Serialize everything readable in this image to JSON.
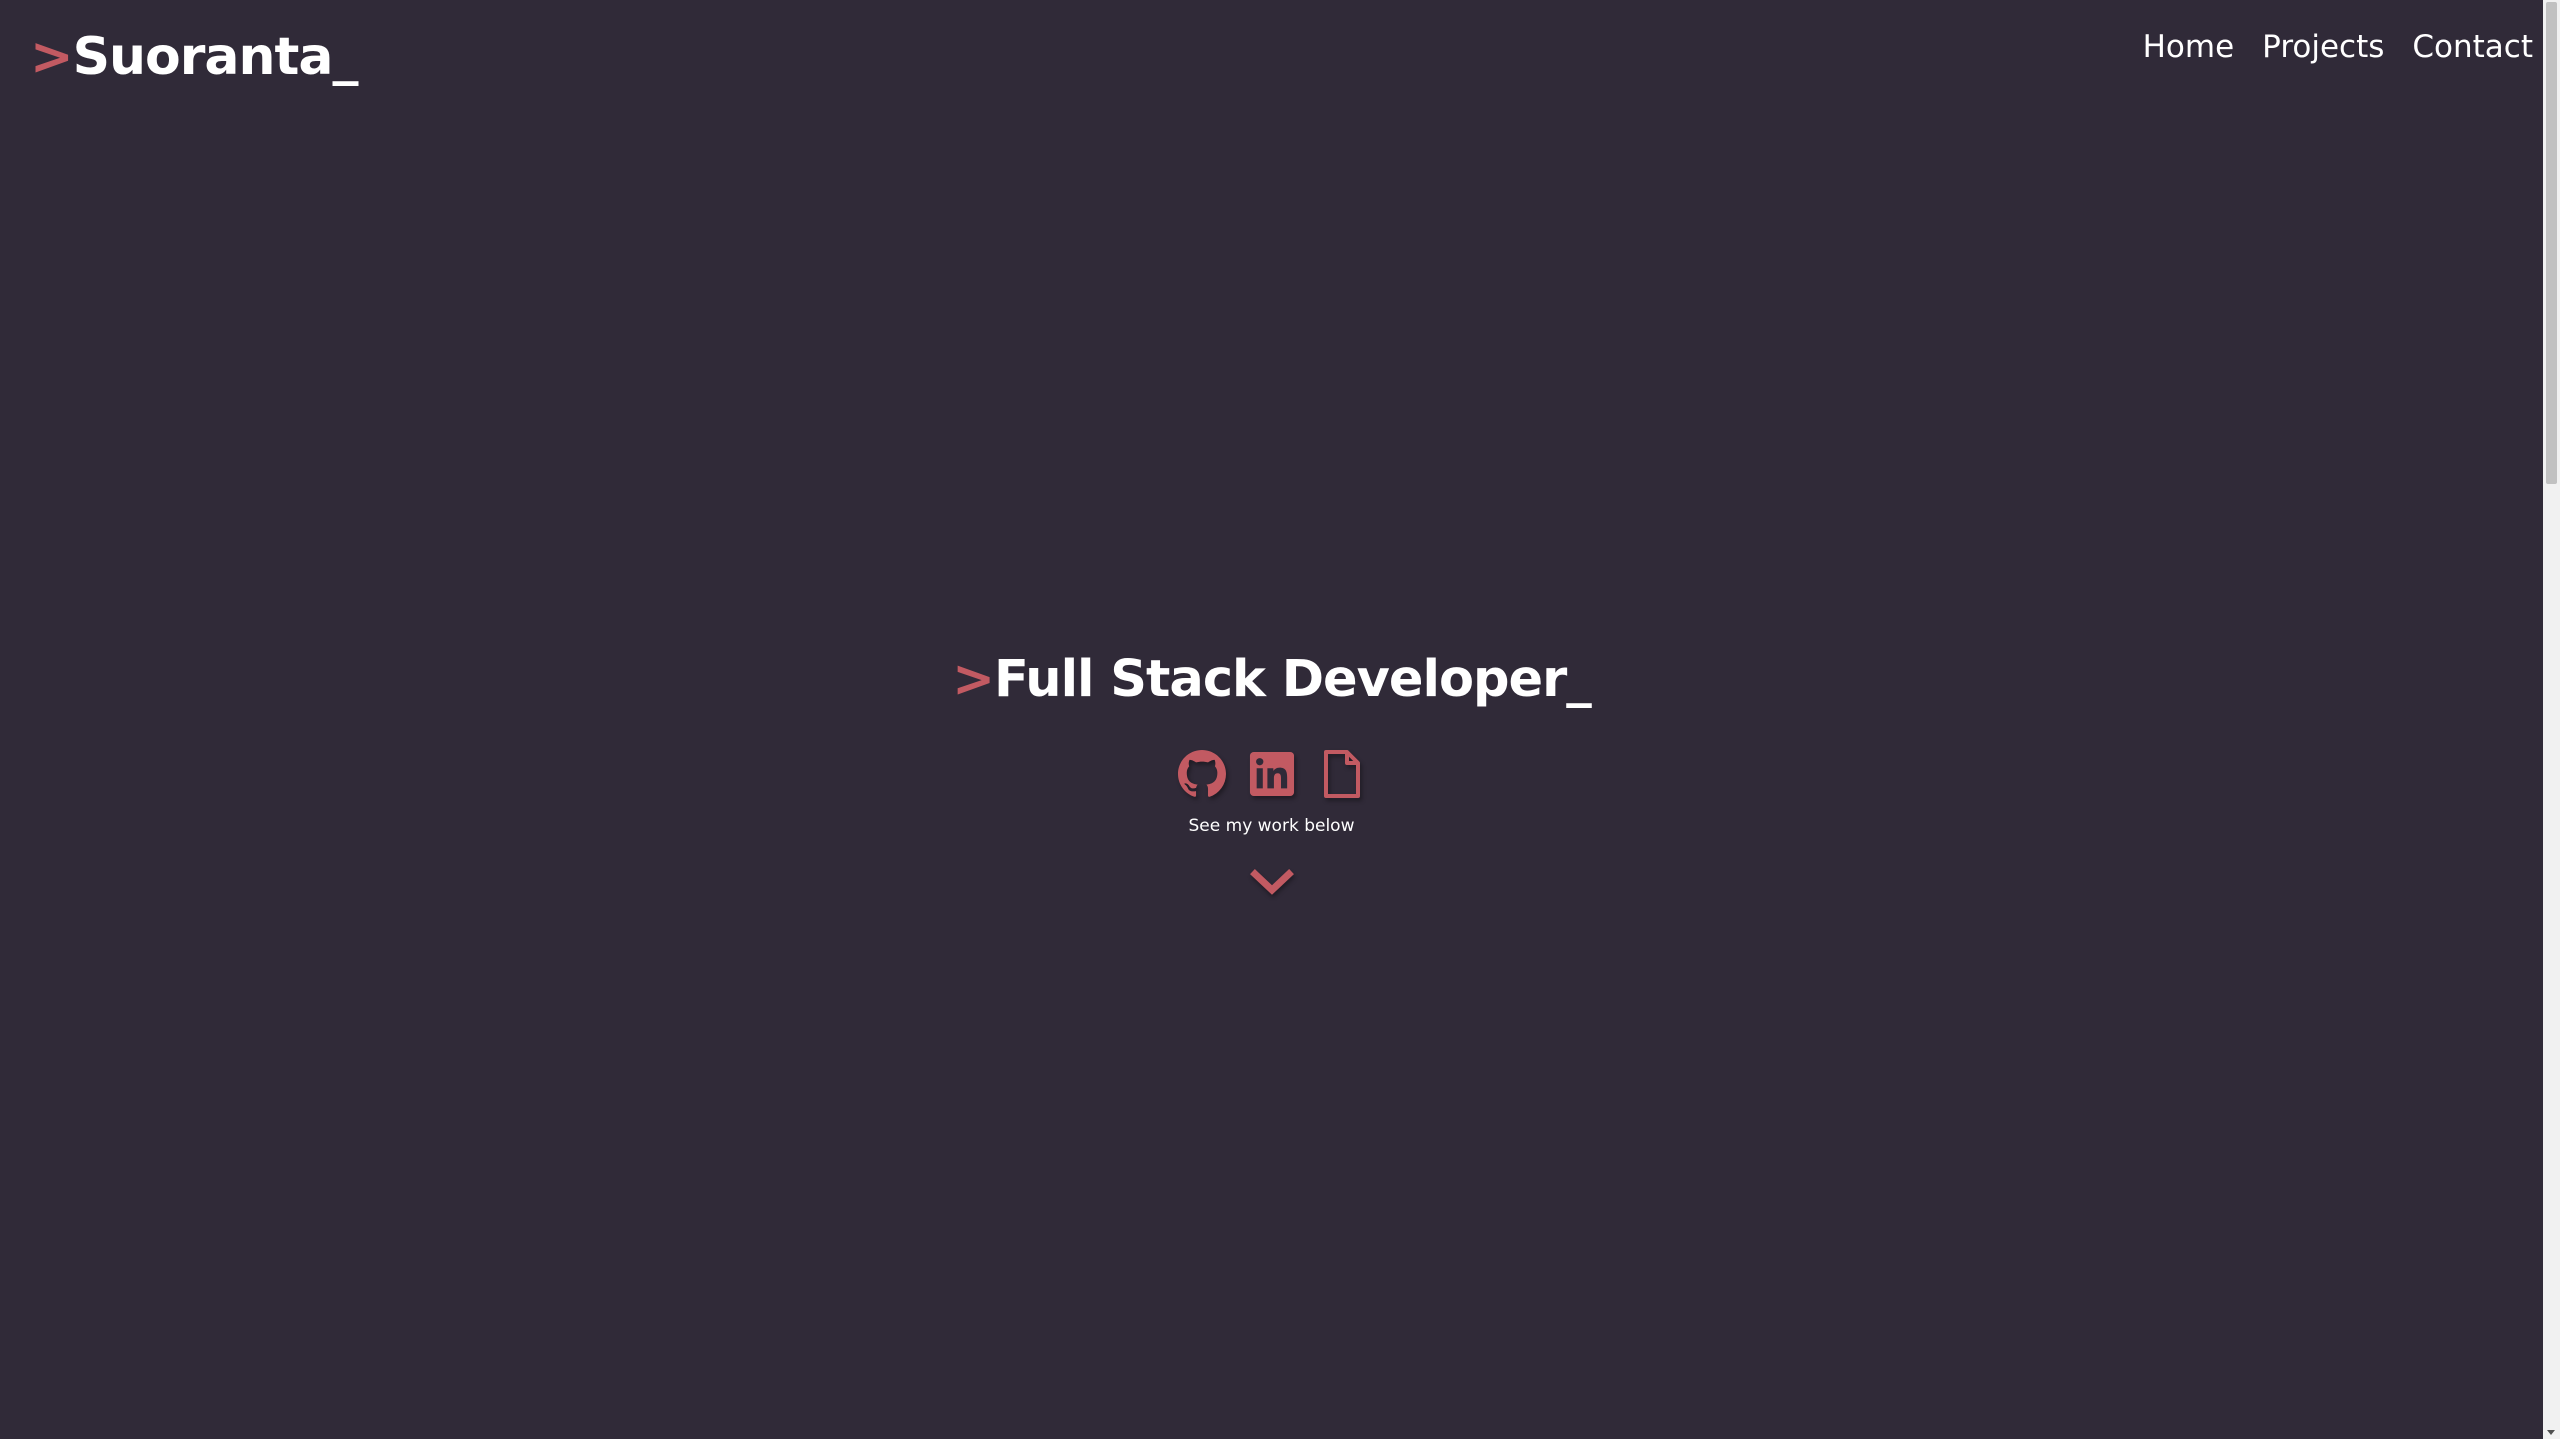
{
  "header": {
    "logo_caret": ">",
    "logo_text": "Suoranta_",
    "nav": {
      "home": "Home",
      "projects": "Projects",
      "contact": "Contact"
    }
  },
  "hero": {
    "title_caret": ">",
    "title_text": "Full Stack Developer_",
    "socials": [
      {
        "icon": "github-icon"
      },
      {
        "icon": "linkedin-icon"
      },
      {
        "icon": "document-icon"
      }
    ],
    "see_work_label": "See my work below",
    "scroll_icon": "chevron-down-icon"
  },
  "colors": {
    "background": "#302a38",
    "accent": "#c25a62",
    "text": "#ffffff"
  }
}
